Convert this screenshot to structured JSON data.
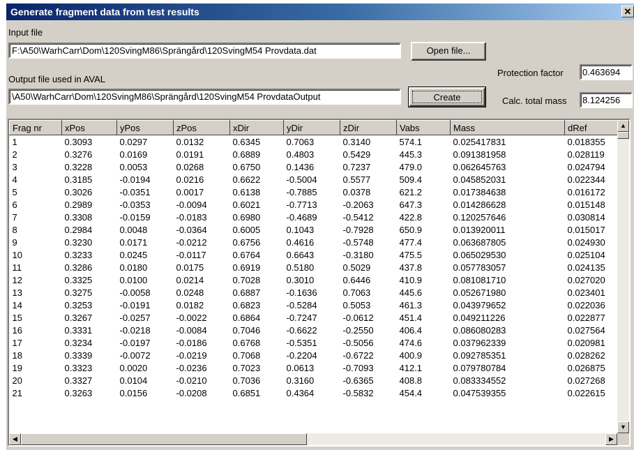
{
  "window": {
    "title": "Generate fragment data from test results",
    "close_glyph": "✕"
  },
  "input": {
    "label": "Input file",
    "value": "F:\\A50\\WarhCarr\\Dom\\120SvingM86\\Sprängård\\120SvingM54 Provdata.dat",
    "open_button": "Open file..."
  },
  "output": {
    "label": "Output file used in AVAL",
    "value": "\\A50\\WarhCarr\\Dom\\120SvingM86\\Sprängård\\120SvingM54 ProvdataOutput",
    "create_button": "Create"
  },
  "protection": {
    "label": "Protection factor",
    "value": "0.463694"
  },
  "mass": {
    "label": "Calc. total mass",
    "value": "8.124256"
  },
  "table": {
    "columns": [
      "Frag nr",
      "xPos",
      "yPos",
      "zPos",
      "xDir",
      "yDir",
      "zDir",
      "Vabs",
      "Mass",
      "dRef"
    ],
    "rows": [
      [
        "1",
        "0.3093",
        "0.0297",
        "0.0132",
        "0.6345",
        "0.7063",
        "0.3140",
        "574.1",
        "0.025417831",
        "0.018355"
      ],
      [
        "2",
        "0.3276",
        "0.0169",
        "0.0191",
        "0.6889",
        "0.4803",
        "0.5429",
        "445.3",
        "0.091381958",
        "0.028119"
      ],
      [
        "3",
        "0.3228",
        "0.0053",
        "0.0268",
        "0.6750",
        "0.1436",
        "0.7237",
        "479.0",
        "0.062645763",
        "0.024794"
      ],
      [
        "4",
        "0.3185",
        "-0.0194",
        "0.0216",
        "0.6622",
        "-0.5004",
        "0.5577",
        "509.4",
        "0.045852031",
        "0.022344"
      ],
      [
        "5",
        "0.3026",
        "-0.0351",
        "0.0017",
        "0.6138",
        "-0.7885",
        "0.0378",
        "621.2",
        "0.017384638",
        "0.016172"
      ],
      [
        "6",
        "0.2989",
        "-0.0353",
        "-0.0094",
        "0.6021",
        "-0.7713",
        "-0.2063",
        "647.3",
        "0.014286628",
        "0.015148"
      ],
      [
        "7",
        "0.3308",
        "-0.0159",
        "-0.0183",
        "0.6980",
        "-0.4689",
        "-0.5412",
        "422.8",
        "0.120257646",
        "0.030814"
      ],
      [
        "8",
        "0.2984",
        "0.0048",
        "-0.0364",
        "0.6005",
        "0.1043",
        "-0.7928",
        "650.9",
        "0.013920011",
        "0.015017"
      ],
      [
        "9",
        "0.3230",
        "0.0171",
        "-0.0212",
        "0.6756",
        "0.4616",
        "-0.5748",
        "477.4",
        "0.063687805",
        "0.024930"
      ],
      [
        "10",
        "0.3233",
        "0.0245",
        "-0.0117",
        "0.6764",
        "0.6643",
        "-0.3180",
        "475.5",
        "0.065029530",
        "0.025104"
      ],
      [
        "11",
        "0.3286",
        "0.0180",
        "0.0175",
        "0.6919",
        "0.5180",
        "0.5029",
        "437.8",
        "0.057783057",
        "0.024135"
      ],
      [
        "12",
        "0.3325",
        "0.0100",
        "0.0214",
        "0.7028",
        "0.3010",
        "0.6446",
        "410.9",
        "0.081081710",
        "0.027020"
      ],
      [
        "13",
        "0.3275",
        "-0.0058",
        "0.0248",
        "0.6887",
        "-0.1636",
        "0.7063",
        "445.6",
        "0.052671980",
        "0.023401"
      ],
      [
        "14",
        "0.3253",
        "-0.0191",
        "0.0182",
        "0.6823",
        "-0.5284",
        "0.5053",
        "461.3",
        "0.043979652",
        "0.022036"
      ],
      [
        "15",
        "0.3267",
        "-0.0257",
        "-0.0022",
        "0.6864",
        "-0.7247",
        "-0.0612",
        "451.4",
        "0.049211226",
        "0.022877"
      ],
      [
        "16",
        "0.3331",
        "-0.0218",
        "-0.0084",
        "0.7046",
        "-0.6622",
        "-0.2550",
        "406.4",
        "0.086080283",
        "0.027564"
      ],
      [
        "17",
        "0.3234",
        "-0.0197",
        "-0.0186",
        "0.6768",
        "-0.5351",
        "-0.5056",
        "474.6",
        "0.037962339",
        "0.020981"
      ],
      [
        "18",
        "0.3339",
        "-0.0072",
        "-0.0219",
        "0.7068",
        "-0.2204",
        "-0.6722",
        "400.9",
        "0.092785351",
        "0.028262"
      ],
      [
        "19",
        "0.3323",
        "0.0020",
        "-0.0236",
        "0.7023",
        "0.0613",
        "-0.7093",
        "412.1",
        "0.079780784",
        "0.026875"
      ],
      [
        "20",
        "0.3327",
        "0.0104",
        "-0.0210",
        "0.7036",
        "0.3160",
        "-0.6365",
        "408.8",
        "0.083334552",
        "0.027268"
      ],
      [
        "21",
        "0.3263",
        "0.0156",
        "-0.0208",
        "0.6851",
        "0.4364",
        "-0.5832",
        "454.4",
        "0.047539355",
        "0.022615"
      ]
    ]
  }
}
